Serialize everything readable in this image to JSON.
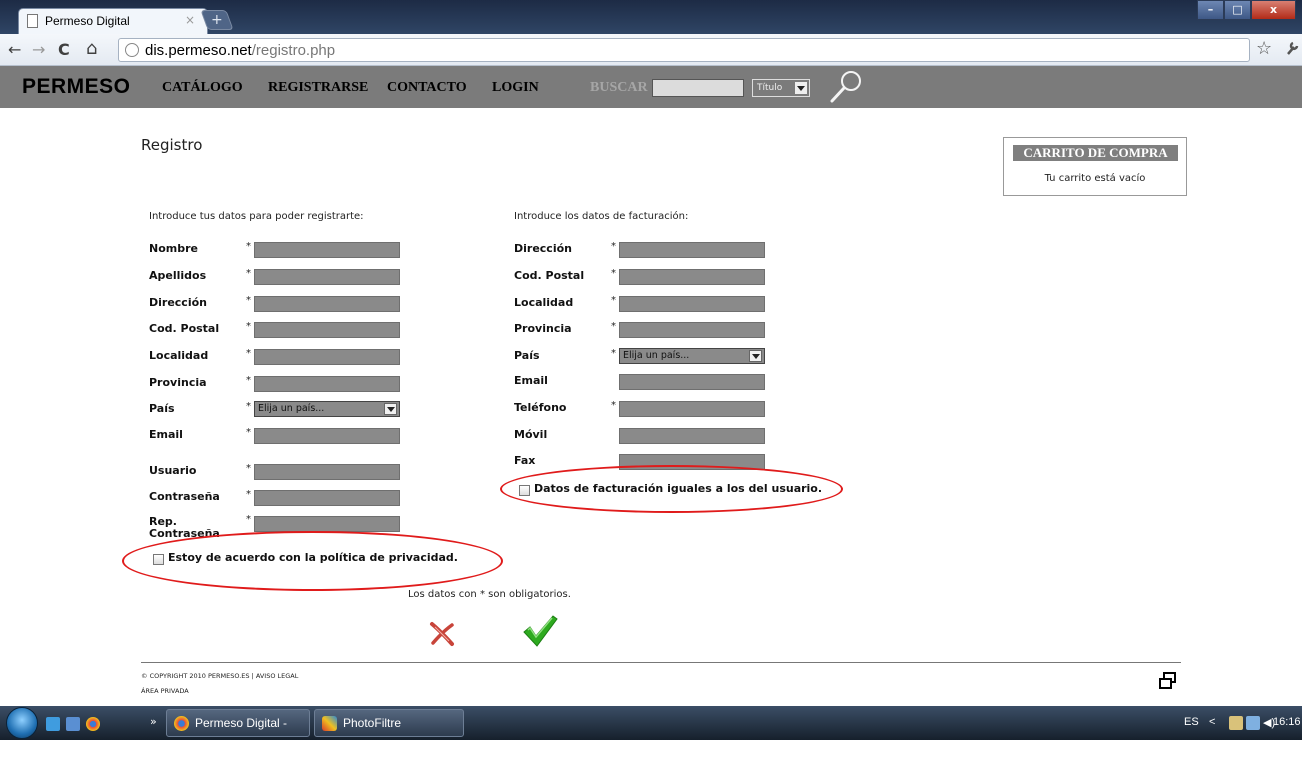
{
  "browser": {
    "tab_title": "Permeso Digital",
    "tab_close": "×",
    "new_tab": "+",
    "back": "←",
    "forward": "→",
    "reload": "C",
    "home": "⌂",
    "url_host": "dis.permeso.net",
    "url_path": "/registro.php",
    "star": "☆",
    "wrench": "🔧",
    "win_min": "–",
    "win_max": "□",
    "win_close": "x"
  },
  "site": {
    "logo": "PERMESO",
    "menu": [
      "CATÁLOGO",
      "REGISTRARSE",
      "CONTACTO",
      "LOGIN"
    ],
    "search_label": "BUSCAR",
    "search_value": "",
    "search_scope": "Título"
  },
  "page": {
    "title": "Registro",
    "cart_title": "CARRITO DE COMPRA",
    "cart_empty": "Tu carrito está vacío",
    "user_intro": "Introduce tus datos para poder registrarte:",
    "billing_intro": "Introduce los datos de facturación:",
    "user_fields": [
      {
        "label": "Nombre",
        "star": "*"
      },
      {
        "label": "Apellidos",
        "star": "*"
      },
      {
        "label": "Dirección",
        "star": "*"
      },
      {
        "label": "Cod. Postal",
        "star": "*"
      },
      {
        "label": "Localidad",
        "star": "*"
      },
      {
        "label": "Provincia",
        "star": "*"
      },
      {
        "label": "País",
        "star": "*",
        "select": "Elija un país..."
      },
      {
        "label": "Email",
        "star": "*"
      },
      {
        "label": "Usuario",
        "star": "*"
      },
      {
        "label": "Contraseña",
        "star": "*"
      },
      {
        "label": "Rep. Contraseña",
        "star": "*"
      }
    ],
    "billing_fields": [
      {
        "label": "Dirección",
        "star": "*"
      },
      {
        "label": "Cod. Postal",
        "star": "*"
      },
      {
        "label": "Localidad",
        "star": "*"
      },
      {
        "label": "Provincia",
        "star": "*"
      },
      {
        "label": "País",
        "star": "*",
        "select": "Elija un país..."
      },
      {
        "label": "Email",
        "star": ""
      },
      {
        "label": "Teléfono",
        "star": "*"
      },
      {
        "label": "Móvil",
        "star": ""
      },
      {
        "label": "Fax",
        "star": ""
      }
    ],
    "billing_same_label": "Datos de facturación iguales a los del usuario.",
    "privacy_label": "Estoy de acuerdo con la política de privacidad.",
    "required_note": "Los datos con * son obligatorios.",
    "copyright": "© COPYRIGHT 2010 PERMESO.ES | AVISO LEGAL",
    "private_area": "ÁREA PRIVADA",
    "highlight_color": "#e01b1b"
  },
  "taskbar": {
    "chevron": "»",
    "buttons": [
      "Permeso Digital - G...",
      "PhotoFiltre"
    ],
    "lang": "ES",
    "tray_arrow": "<",
    "clock": "16:16"
  }
}
